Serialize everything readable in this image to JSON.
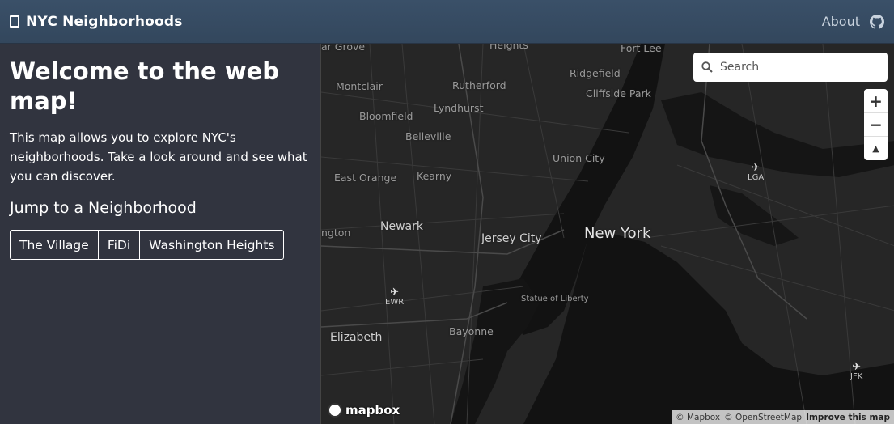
{
  "navbar": {
    "title": "NYC Neighborhoods",
    "about_label": "About"
  },
  "sidebar": {
    "heading": "Welcome to the web map!",
    "intro": "This map allows you to explore NYC's neighborhoods. Take a look around and see what you can discover.",
    "jump_heading": "Jump to a Neighborhood",
    "buttons": [
      "The Village",
      "FiDi",
      "Washington Heights"
    ]
  },
  "map": {
    "search_placeholder": "Search",
    "zoom_in": "+",
    "zoom_out": "−",
    "compass": "▲",
    "places": {
      "garfield": "ar Grove",
      "heights": "Heights",
      "fort_lee": "Fort Lee",
      "montclair": "Montclair",
      "rutherford": "Rutherford",
      "ridgefield": "Ridgefield",
      "lyndhurst": "Lyndhurst",
      "cliffside": "Cliffside Park",
      "bloomfield": "Bloomfield",
      "belleville": "Belleville",
      "union_city": "Union City",
      "east_orange": "East Orange",
      "kearny": "Kearny",
      "newark": "Newark",
      "jersey_city": "Jersey City",
      "new_york": "New York",
      "ington": "ngton",
      "statue": "Statue of Liberty",
      "bayonne": "Bayonne",
      "elizabeth": "Elizabeth"
    },
    "airports": {
      "lga": "LGA",
      "ewr": "EWR",
      "jfk": "JFK"
    },
    "logo_text": "mapbox",
    "attribution": {
      "mapbox": "© Mapbox",
      "osm": "© OpenStreetMap",
      "improve": "Improve this map"
    }
  }
}
